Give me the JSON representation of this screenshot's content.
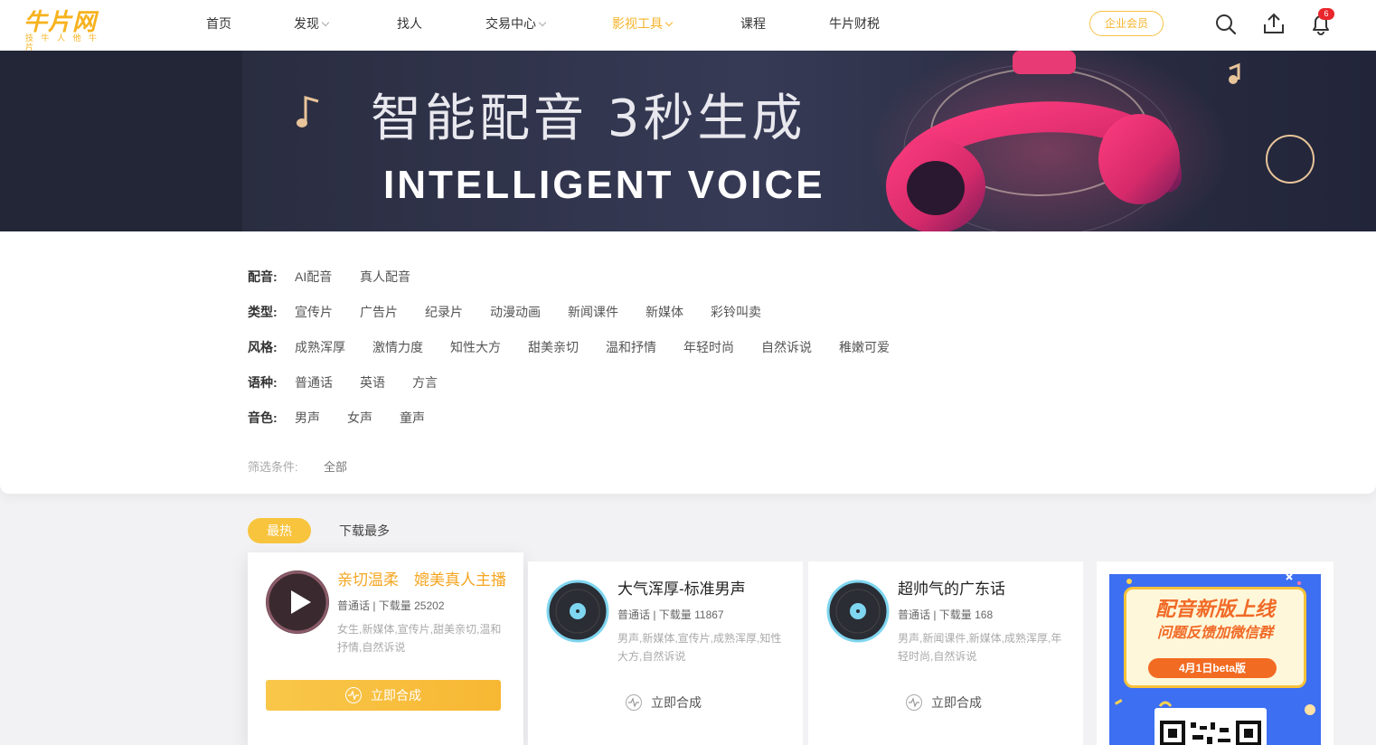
{
  "header": {
    "logo_text": "牛片网",
    "logo_sub": "技 牛 人 他 牛 片",
    "nav": [
      {
        "label": "首页",
        "dropdown": false,
        "active": false
      },
      {
        "label": "发现",
        "dropdown": true,
        "active": false
      },
      {
        "label": "找人",
        "dropdown": false,
        "active": false
      },
      {
        "label": "交易中心",
        "dropdown": true,
        "active": false
      },
      {
        "label": "影视工具",
        "dropdown": true,
        "active": true
      },
      {
        "label": "课程",
        "dropdown": false,
        "active": false
      },
      {
        "label": "牛片财税",
        "dropdown": false,
        "active": false
      }
    ],
    "vip_label": "企业会员",
    "icons": [
      "search-icon",
      "upload-icon",
      "bell-icon"
    ],
    "notification_count": "6"
  },
  "banner": {
    "title": "智能配音 3秒生成",
    "subtitle": "INTELLIGENT VOICE"
  },
  "filters": {
    "rows": [
      {
        "label": "配音:",
        "options": [
          "AI配音",
          "真人配音"
        ]
      },
      {
        "label": "类型:",
        "options": [
          "宣传片",
          "广告片",
          "纪录片",
          "动漫动画",
          "新闻课件",
          "新媒体",
          "彩铃叫卖"
        ]
      },
      {
        "label": "风格:",
        "options": [
          "成熟浑厚",
          "激情力度",
          "知性大方",
          "甜美亲切",
          "温和抒情",
          "年轻时尚",
          "自然诉说",
          "稚嫩可爱"
        ]
      },
      {
        "label": "语种:",
        "options": [
          "普通话",
          "英语",
          "方言"
        ]
      },
      {
        "label": "音色:",
        "options": [
          "男声",
          "女声",
          "童声"
        ]
      }
    ],
    "selected_label": "筛选条件:",
    "selected_value": "全部"
  },
  "tabs": {
    "hot": "最热",
    "downloads": "下载最多"
  },
  "cards": [
    {
      "title": "亲切温柔　媲美真人主播",
      "meta": "普通话 | 下载量 25202",
      "tags": "女生,新媒体,宣传片,甜美亲切,温和抒情,自然诉说",
      "action": "立即合成"
    },
    {
      "title": "大气浑厚-标准男声",
      "meta": "普通话 | 下载量 11867",
      "tags": "男声,新媒体,宣传片,成熟浑厚,知性大方,自然诉说",
      "action": "立即合成"
    },
    {
      "title": "超帅气的广东话",
      "meta": "普通话 | 下载量 168",
      "tags": "男声,新闻课件,新媒体,成熟浑厚,年轻时尚,自然诉说",
      "action": "立即合成"
    }
  ],
  "promo": {
    "title": "配音新版上线",
    "subtitle": "问题反馈加微信群",
    "date": "4月1日beta版"
  },
  "colors": {
    "accent": "#f5b32a",
    "badge": "#e8262c",
    "promo_bg": "#3d6ff2",
    "promo_orange": "#f06a27"
  }
}
